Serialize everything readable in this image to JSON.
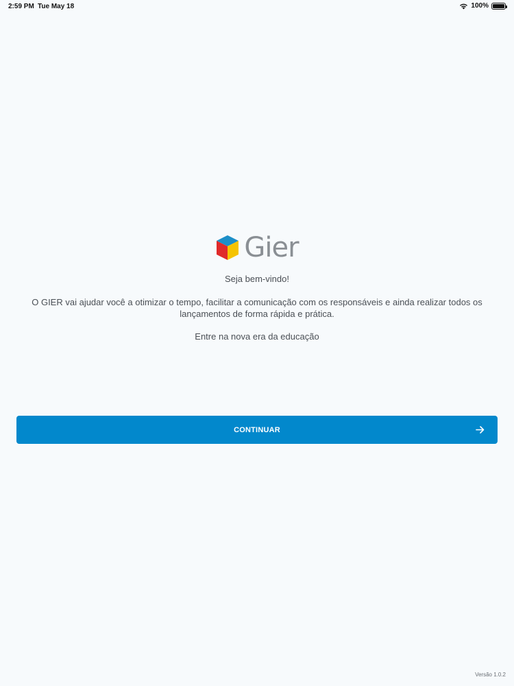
{
  "status_bar": {
    "time": "2:59 PM",
    "date": "Tue May 18",
    "battery": "100%",
    "battery_level": 1.0,
    "icons": [
      "wifi-icon",
      "battery-icon"
    ]
  },
  "logo": {
    "text": "Gier",
    "colors": {
      "top": "#1c8fc8",
      "left": "#e02a2a",
      "right": "#f5c400"
    }
  },
  "welcome": "Seja bem-vindo!",
  "description": "O GIER vai ajudar você a otimizar o tempo, facilitar a comunicação com os responsáveis e ainda realizar todos os lançamentos de forma rápida e prática.",
  "tagline": "Entre na nova era da educação",
  "continue_button": {
    "label": "CONTINUAR",
    "icon": "arrow-right-icon",
    "color": "#0288cc"
  },
  "version": "Versão 1.0.2"
}
